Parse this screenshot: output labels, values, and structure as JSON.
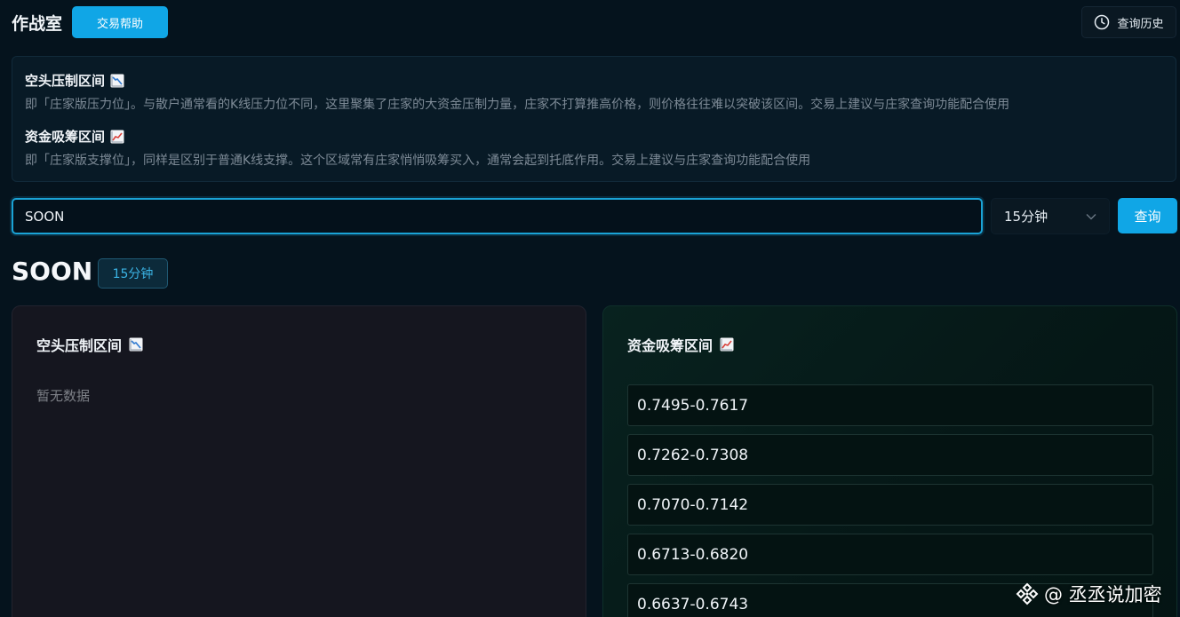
{
  "header": {
    "title": "作战室",
    "help_label": "交易帮助",
    "history_label": "查询历史"
  },
  "info": {
    "resistance_title": "空头压制区间",
    "resistance_desc": "即「庄家版压力位」。与散户通常看的K线压力位不同，这里聚集了庄家的大资金压制力量，庄家不打算推高价格，则价格往往难以突破该区间。交易上建议与庄家查询功能配合使用",
    "support_title": "资金吸筹区间",
    "support_desc": "即「庄家版支撑位」，同样是区别于普通K线支撑。这个区域常有庄家悄悄吸筹买入，通常会起到托底作用。交易上建议与庄家查询功能配合使用"
  },
  "search": {
    "value": "SOON",
    "interval_selected": "15分钟",
    "query_label": "查询"
  },
  "result": {
    "symbol": "SOON",
    "interval_tag": "15分钟",
    "resistance_panel": {
      "title": "空头压制区间",
      "empty_text": "暂无数据"
    },
    "support_panel": {
      "title": "资金吸筹区间",
      "zones": [
        "0.7495-0.7617",
        "0.7262-0.7308",
        "0.7070-0.7142",
        "0.6713-0.6820",
        "0.6637-0.6743"
      ]
    }
  },
  "watermark": {
    "text": "@ 丞丞说加密"
  },
  "colors": {
    "accent": "#10a6e6",
    "background": "#05131d",
    "panel_left": "#15161f",
    "panel_right": "#08221f"
  },
  "icons": {
    "resistance": "chart-decreasing-icon",
    "support": "chart-increasing-icon",
    "history": "clock-icon",
    "select": "chevron-down-icon",
    "watermark": "binance-logo-icon"
  }
}
